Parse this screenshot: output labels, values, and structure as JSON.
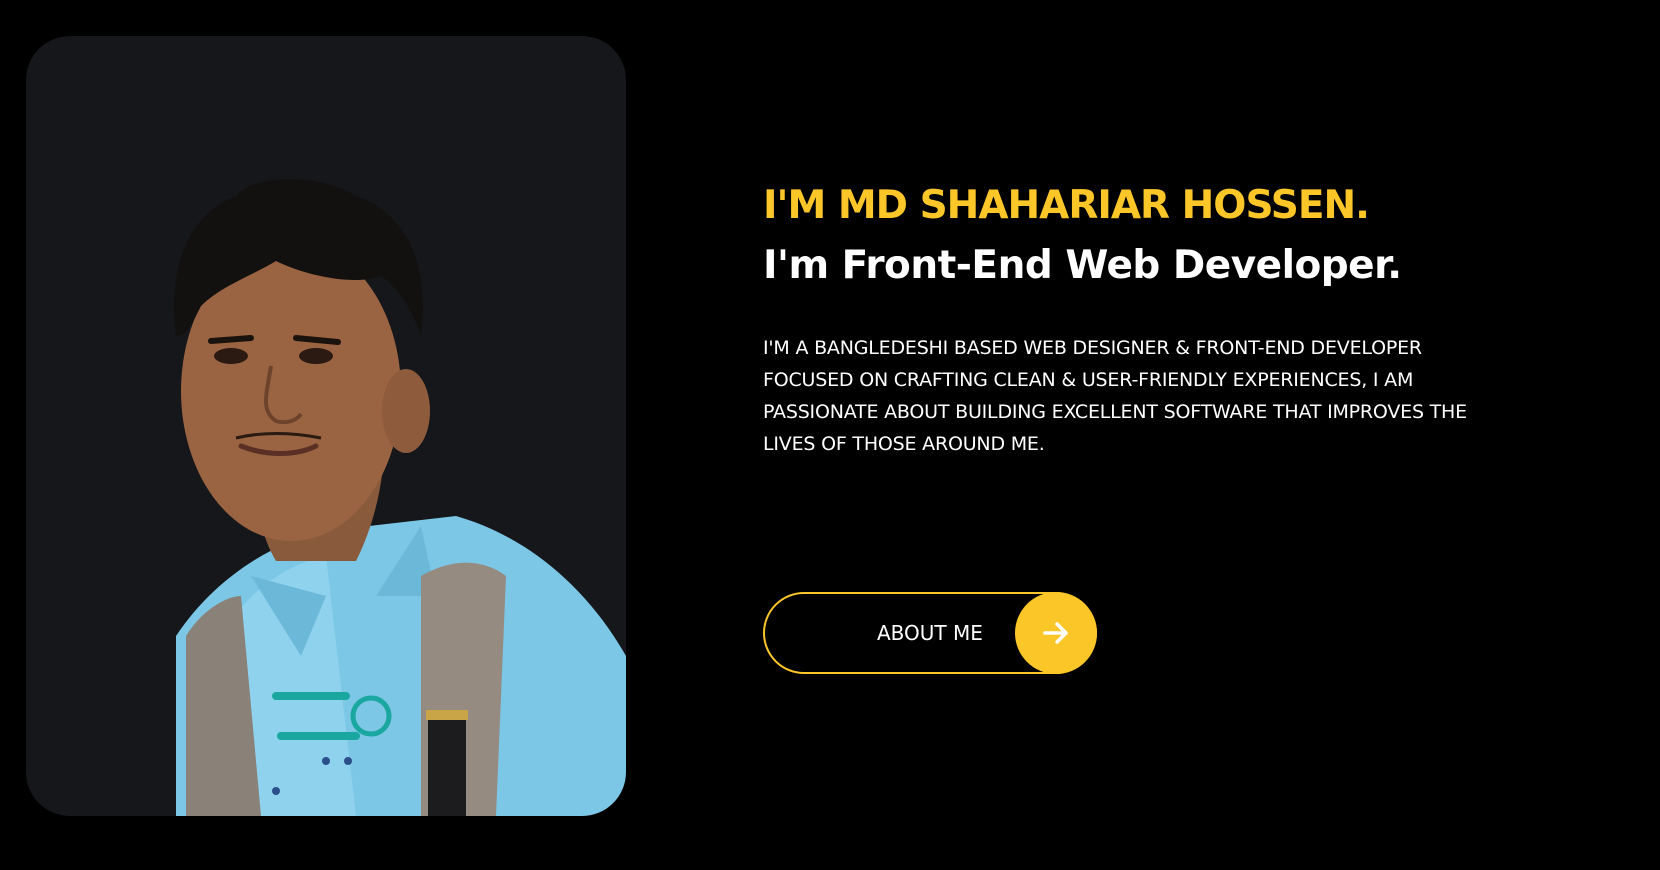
{
  "hero": {
    "name_line": "I'M MD SHAHARIAR HOSSEN.",
    "role_line": "I'm Front-End Web Developer.",
    "intro": "I'M A BANGLEDESHI BASED WEB DESIGNER & FRONT-END DEVELOPER FOCUSED ON CRAFTING CLEAN & USER-FRIENDLY EXPERIENCES, I AM PASSIONATE ABOUT BUILDING EXCELLENT SOFTWARE THAT IMPROVES THE LIVES OF THOSE AROUND ME.",
    "cta_label": "ABOUT ME",
    "cta_icon": "arrow-right-icon"
  },
  "photo": {
    "subject": "profile-photo"
  },
  "colors": {
    "accent": "#fbc628",
    "background": "#000000",
    "card": "#16171b",
    "text": "#ffffff"
  }
}
